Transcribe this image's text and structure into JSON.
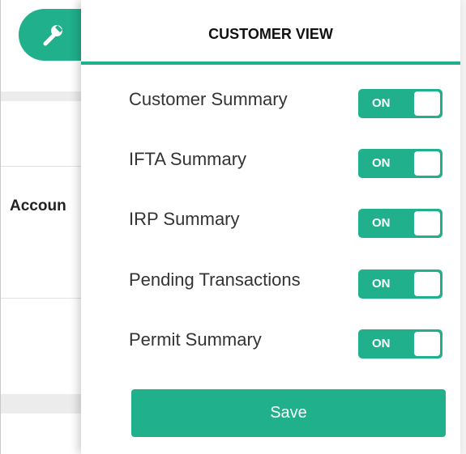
{
  "background": {
    "account_label": "Accoun",
    "faint_text": "· · · · · · · ·"
  },
  "panel": {
    "title": "CUSTOMER VIEW",
    "options": [
      {
        "label": "Customer Summary",
        "state": "ON"
      },
      {
        "label": "IFTA Summary",
        "state": "ON"
      },
      {
        "label": "IRP Summary",
        "state": "ON"
      },
      {
        "label": "Pending Transactions",
        "state": "ON"
      },
      {
        "label": "Permit Summary",
        "state": "ON"
      }
    ],
    "save_label": "Save"
  },
  "icons": {
    "settings_tab": "wrench-icon"
  },
  "colors": {
    "accent": "#21b08c",
    "text": "#333333",
    "title": "#111111"
  }
}
